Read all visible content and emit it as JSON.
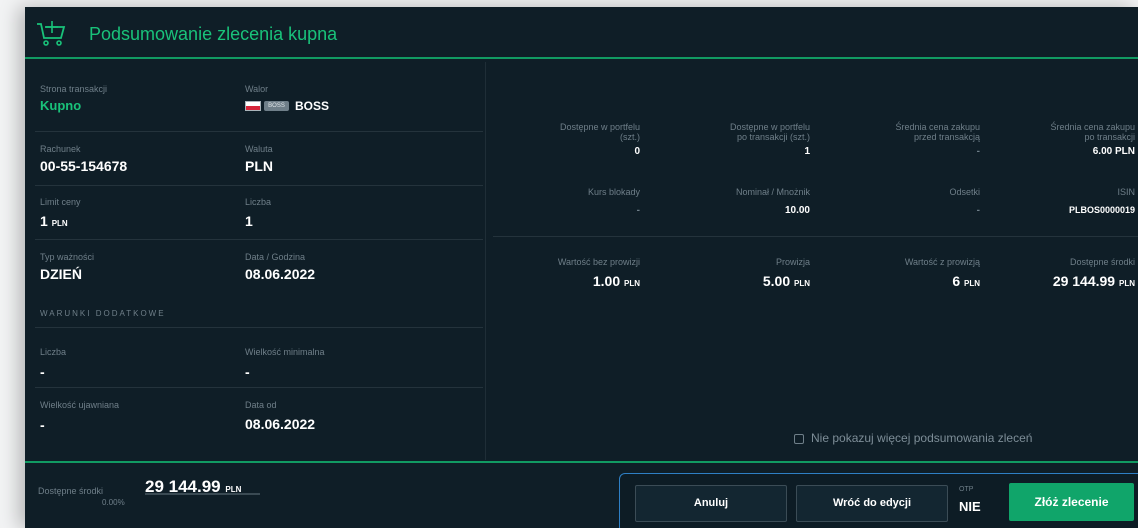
{
  "header": {
    "title": "Podsumowanie zlecenia kupna",
    "icon": "cart-plus-icon",
    "accent_color": "#19c27a"
  },
  "left": {
    "transaction_side": {
      "label": "Strona transakcji",
      "value": "Kupno"
    },
    "instrument": {
      "label": "Walor",
      "badge": "BOSS",
      "name": "BOSS"
    },
    "account": {
      "label": "Rachunek",
      "value": "00-55-154678"
    },
    "currency": {
      "label": "Waluta",
      "value": "PLN"
    },
    "price_limit": {
      "label": "Limit ceny",
      "value": "1",
      "unit": "PLN"
    },
    "quantity": {
      "label": "Liczba",
      "value": "1"
    },
    "validity_type": {
      "label": "Typ ważności",
      "value": "DZIEŃ"
    },
    "datetime": {
      "label": "Data / Godzina",
      "value": "08.06.2022"
    },
    "extra_conditions": {
      "heading": "WARUNKI DODATKOWE",
      "quantity": {
        "label": "Liczba",
        "value": "-"
      },
      "min_size": {
        "label": "Wielkość minimalna",
        "value": "-"
      },
      "disclosed_size": {
        "label": "Wielkość ujawniana",
        "value": "-"
      },
      "date_from": {
        "label": "Data od",
        "value": "08.06.2022"
      }
    }
  },
  "right": {
    "row1": [
      {
        "label": "Dostępne w portfelu",
        "label2": "(szt.)",
        "value": "0"
      },
      {
        "label": "Dostępne w portfelu",
        "label2": "po transakcji (szt.)",
        "value": "1"
      },
      {
        "label": "Średnia cena zakupu",
        "label2": "przed transakcją",
        "value": "-"
      },
      {
        "label": "Średnia cena zakupu",
        "label2": "po transakcji",
        "value": "6.00 PLN"
      }
    ],
    "row2": [
      {
        "label": "Kurs blokady",
        "value": "-"
      },
      {
        "label": "Nominał / Mnożnik",
        "value": "10.00"
      },
      {
        "label": "Odsetki",
        "value": "-"
      },
      {
        "label": "ISIN",
        "value": "PLBOS0000019"
      }
    ],
    "row3": [
      {
        "label": "Wartość bez prowizji",
        "value": "1.00",
        "unit": "PLN"
      },
      {
        "label": "Prowizja",
        "value": "5.00",
        "unit": "PLN"
      },
      {
        "label": "Wartość z prowizją",
        "value": "6",
        "unit": "PLN"
      },
      {
        "label": "Dostępne środki",
        "value": "29 144.99",
        "unit": "PLN"
      }
    ],
    "no_summary_checkbox": {
      "label": "Nie pokazuj więcej podsumowania zleceń",
      "checked": false
    }
  },
  "footer": {
    "available_funds": {
      "label": "Dostępne środki",
      "value": "29 144.99",
      "unit": "PLN",
      "percent": "0.00%",
      "progress": 0
    },
    "buttons": {
      "cancel": "Anuluj",
      "back_to_edit": "Wróć do edycji",
      "submit": "Złóż zlecenie"
    },
    "otp": {
      "label": "OTP",
      "value": "NIE"
    }
  }
}
